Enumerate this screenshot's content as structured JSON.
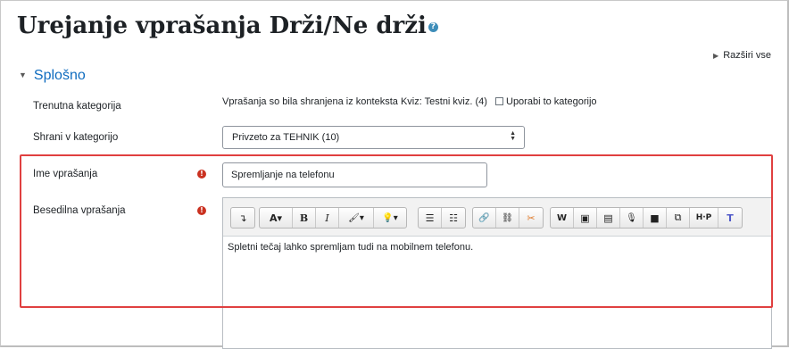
{
  "page": {
    "title": "Urejanje vprašanja Drži/Ne drži",
    "help_glyph": "?",
    "expand_all": "Razširi vse"
  },
  "section": {
    "title": "Splošno"
  },
  "fields": {
    "current_category": {
      "label": "Trenutna kategorija",
      "value": "Vprašanja so bila shranjena iz konteksta Kviz: Testni kviz. (4)",
      "checkbox_label": "Uporabi to kategorijo"
    },
    "save_in_category": {
      "label": "Shrani v kategorijo",
      "selected": "Privzeto za TEHNIK (10)"
    },
    "question_name": {
      "label": "Ime vprašanja",
      "value": "Spremljanje na telefonu",
      "required_glyph": "!"
    },
    "question_text": {
      "label": "Besedilna vprašanja",
      "required_glyph": "!",
      "content": "Spletni tečaj lahko spremljam tudi na mobilnem telefonu."
    }
  },
  "toolbar": {
    "items": [
      {
        "name": "collapse-toggle-button",
        "glyph": "↴"
      },
      {
        "name": "font-style-button",
        "glyph": "A▾"
      },
      {
        "name": "bold-button",
        "glyph": "B"
      },
      {
        "name": "italic-button",
        "glyph": "I"
      },
      {
        "name": "text-color-button",
        "glyph": "🖌▾"
      },
      {
        "name": "emoji-button",
        "glyph": "💡▾"
      },
      {
        "name": "unordered-list-button",
        "glyph": "☰"
      },
      {
        "name": "ordered-list-button",
        "glyph": "☷"
      },
      {
        "name": "link-button",
        "glyph": "🔗"
      },
      {
        "name": "unlink-button",
        "glyph": "⛓"
      },
      {
        "name": "no-autolink-button",
        "glyph": "✂"
      },
      {
        "name": "word-import-button",
        "glyph": "W"
      },
      {
        "name": "image-button",
        "glyph": "▣"
      },
      {
        "name": "media-button",
        "glyph": "▤"
      },
      {
        "name": "record-audio-button",
        "glyph": "🎙"
      },
      {
        "name": "record-video-button",
        "glyph": "■"
      },
      {
        "name": "manage-files-button",
        "glyph": "⧉"
      },
      {
        "name": "h5p-button",
        "glyph": "H·P"
      },
      {
        "name": "teams-button",
        "glyph": "T"
      }
    ]
  },
  "colors": {
    "link": "#0f6cbf",
    "required": "#ca3120",
    "highlight": "#e04040"
  }
}
